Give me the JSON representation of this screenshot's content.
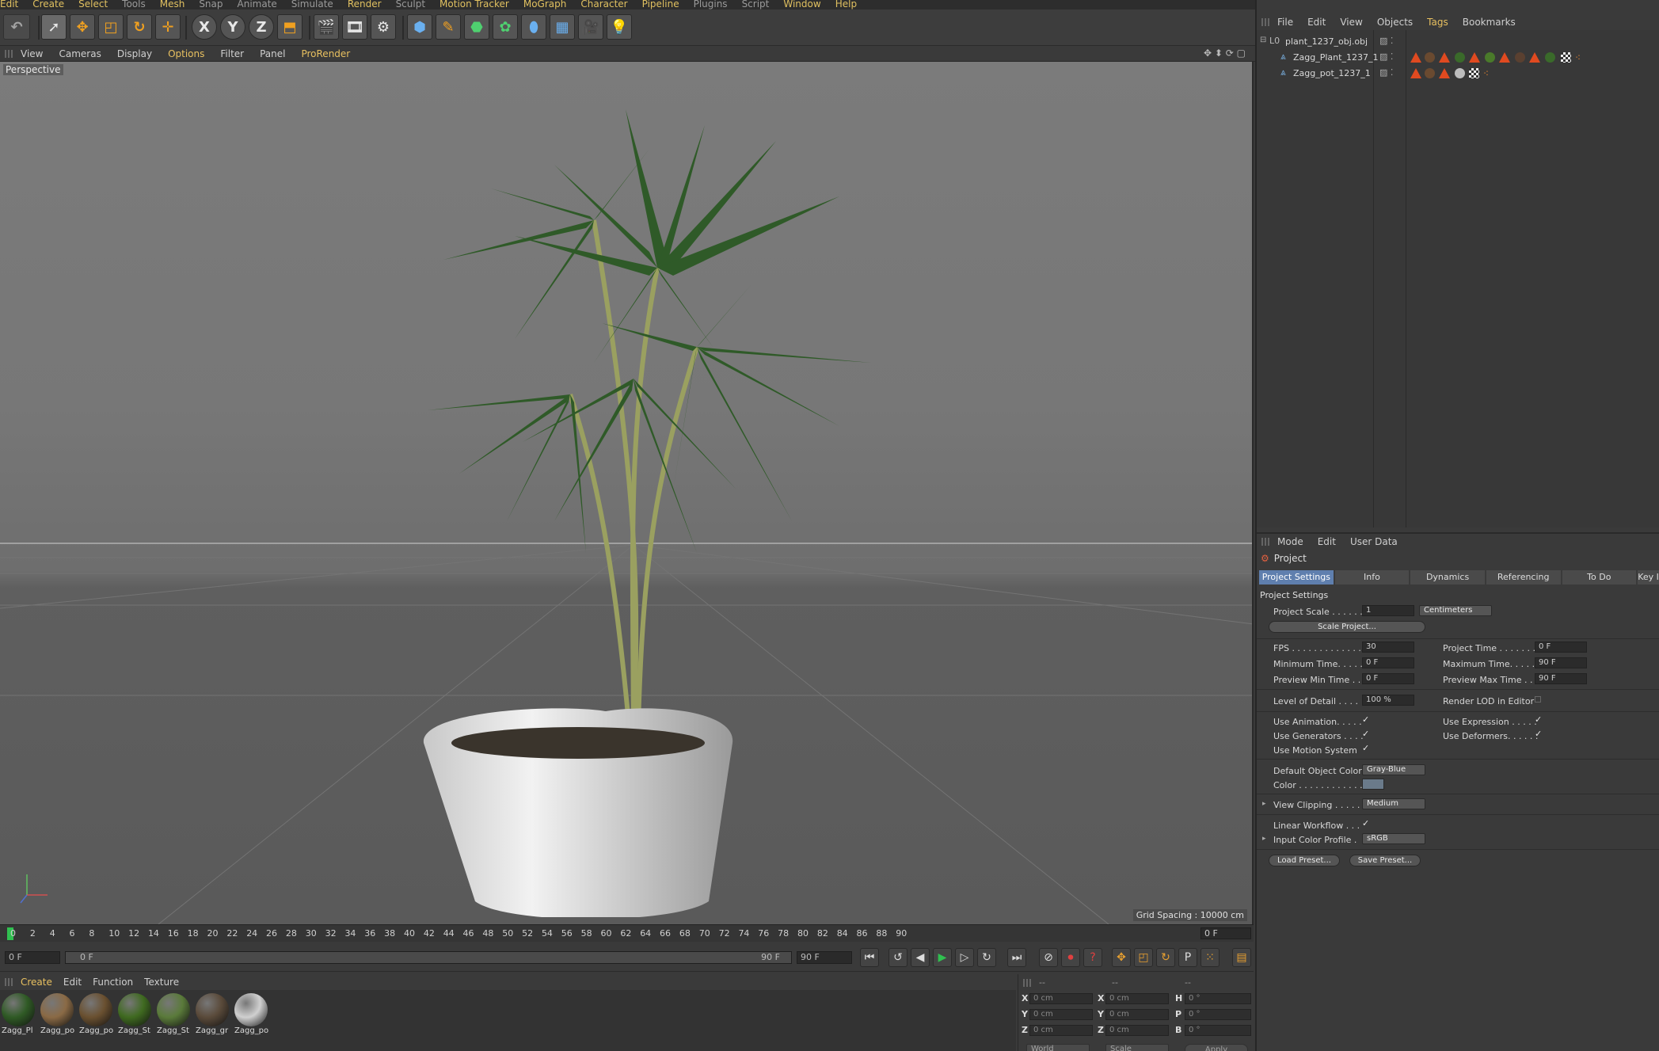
{
  "menubar": [
    "Edit",
    "Create",
    "Select",
    "Tools",
    "Mesh",
    "Snap",
    "Animate",
    "Simulate",
    "Render",
    "Sculpt",
    "Motion Tracker",
    "MoGraph",
    "Character",
    "Pipeline",
    "Plugins",
    "Script",
    "Window",
    "Help"
  ],
  "viewport_menu": [
    "View",
    "Cameras",
    "Display",
    "Options",
    "Filter",
    "Panel",
    "ProRender"
  ],
  "viewport": {
    "label": "Perspective",
    "grid_spacing": "Grid Spacing : 10000 cm"
  },
  "toolbar": {
    "x": "X",
    "y": "Y",
    "z": "Z"
  },
  "timeline": {
    "ticks": [
      "0",
      "2",
      "4",
      "6",
      "8",
      "10",
      "12",
      "14",
      "16",
      "18",
      "20",
      "22",
      "24",
      "26",
      "28",
      "30",
      "32",
      "34",
      "36",
      "38",
      "40",
      "42",
      "44",
      "46",
      "48",
      "50",
      "52",
      "54",
      "56",
      "58",
      "60",
      "62",
      "64",
      "66",
      "68",
      "70",
      "72",
      "74",
      "76",
      "78",
      "80",
      "82",
      "84",
      "86",
      "88",
      "90"
    ],
    "current_frame": "0 F"
  },
  "transport": {
    "start": "0 F",
    "range_start": "0 F",
    "range_end": "90 F",
    "end": "90 F"
  },
  "material_menu": [
    "Create",
    "Edit",
    "Function",
    "Texture"
  ],
  "materials": [
    {
      "label": "Zagg_Pl",
      "color": "#2f5a25"
    },
    {
      "label": "Zagg_po",
      "color": "#8a6a45"
    },
    {
      "label": "Zagg_po",
      "color": "#6a5030"
    },
    {
      "label": "Zagg_St",
      "color": "#3f6a20"
    },
    {
      "label": "Zagg_St",
      "color": "#5a7a3a"
    },
    {
      "label": "Zagg_gr",
      "color": "#5a4a3a"
    },
    {
      "label": "Zagg_po",
      "color": "#d0d0d0"
    }
  ],
  "coords": {
    "header": [
      "--",
      "--",
      "--"
    ],
    "rows": [
      {
        "a": "X",
        "av": "0 cm",
        "b": "X",
        "bv": "0 cm",
        "c": "H",
        "cv": "0 °"
      },
      {
        "a": "Y",
        "av": "0 cm",
        "b": "Y",
        "bv": "0 cm",
        "c": "P",
        "cv": "0 °"
      },
      {
        "a": "Z",
        "av": "0 cm",
        "b": "Z",
        "bv": "0 cm",
        "c": "B",
        "cv": "0 °"
      }
    ],
    "world": "World",
    "scale": "Scale",
    "apply": "Apply"
  },
  "object_manager": {
    "menu": [
      "File",
      "Edit",
      "View",
      "Objects",
      "Tags",
      "Bookmarks"
    ],
    "objects": [
      {
        "name": "plant_1237_obj.obj"
      },
      {
        "name": "Zagg_Plant_1237_1"
      },
      {
        "name": "Zagg_pot_1237_1"
      }
    ]
  },
  "attribute_manager": {
    "menu": [
      "Mode",
      "Edit",
      "User Data"
    ],
    "title": "Project",
    "tabs": [
      "Project Settings",
      "Info",
      "Dynamics",
      "Referencing",
      "To Do",
      "Key I"
    ],
    "section": "Project Settings",
    "fields": {
      "project_scale_label": "Project Scale . . . . . .",
      "project_scale": "1",
      "units": "Centimeters",
      "scale_project": "Scale Project...",
      "fps_label": "FPS . . . . . . . . . . . . . . .",
      "fps": "30",
      "project_time_label": "Project Time . . . . . . . .",
      "project_time": "0 F",
      "min_time_label": "Minimum Time. . . . . . .",
      "min_time": "0 F",
      "max_time_label": "Maximum Time. . . . . . .",
      "max_time": "90 F",
      "prev_min_label": "Preview Min Time . .",
      "prev_min": "0 F",
      "prev_max_label": "Preview Max Time . .",
      "prev_max": "90 F",
      "lod_label": "Level of Detail . . . .",
      "lod": "100 %",
      "render_lod_label": "Render LOD in Editor",
      "use_anim_label": "Use Animation. . . . .",
      "use_expr_label": "Use Expression . . . . .",
      "use_gen_label": "Use Generators . . . .",
      "use_def_label": "Use Deformers. . . . . .",
      "use_motion_label": "Use Motion System",
      "def_color_label": "Default Object Color",
      "def_color": "Gray-Blue",
      "color_label": "Color . . . . . . . . . . . .",
      "view_clip_label": "View Clipping . . . . .",
      "view_clip": "Medium",
      "linear_label": "Linear Workflow . . .",
      "input_profile_label": "Input Color Profile .",
      "input_profile": "sRGB",
      "load_preset": "Load Preset...",
      "save_preset": "Save Preset..."
    }
  },
  "colors": {
    "accent": "#e8c060",
    "active_tab": "#5f7fae",
    "play": "#30c050"
  }
}
